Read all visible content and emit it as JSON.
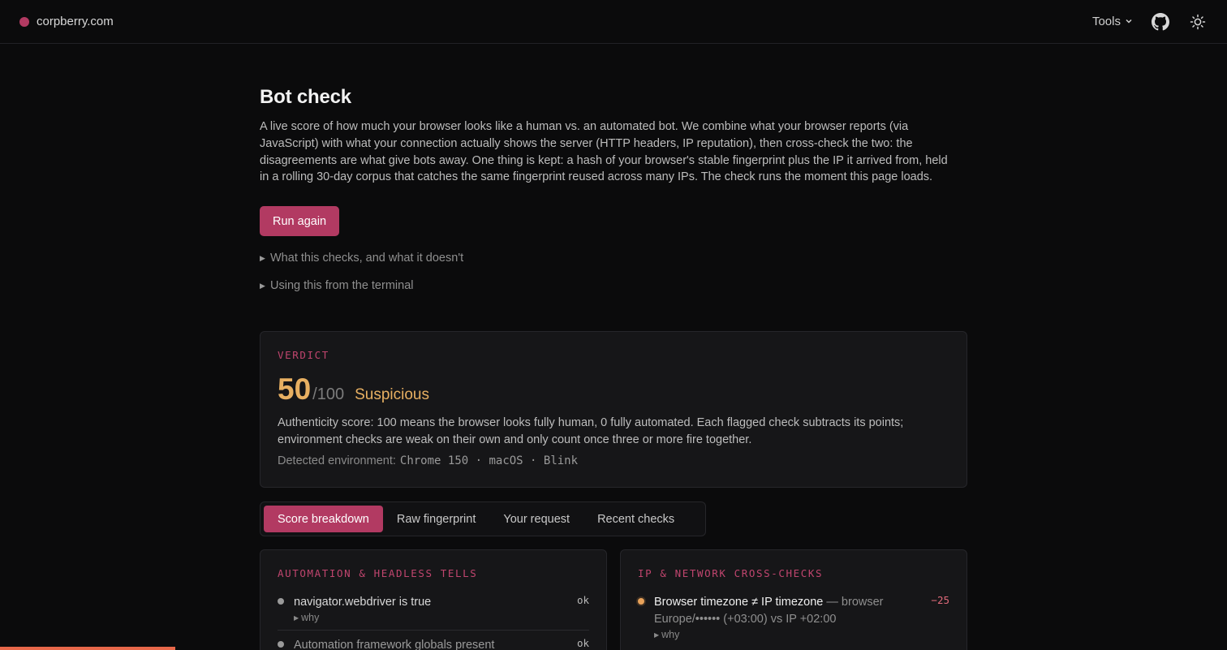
{
  "header": {
    "brand": "corpberry.com",
    "tools_label": "Tools",
    "github_icon": "github-icon",
    "theme_icon": "sun-icon",
    "accent": "#b23a62"
  },
  "main": {
    "title": "Bot check",
    "intro": "A live score of how much your browser looks like a human vs. an automated bot. We combine what your browser reports (via JavaScript) with what your connection actually shows the server (HTTP headers, IP reputation), then cross-check the two: the disagreements are what give bots away. One thing is kept: a hash of your browser's stable fingerprint plus the IP it arrived from, held in a rolling 30-day corpus that catches the same fingerprint reused across many IPs. The check runs the moment this page loads.",
    "run_button": "Run again",
    "disclosure_checks": "What this checks, and what it doesn't",
    "disclosure_terminal": "Using this from the terminal"
  },
  "verdict": {
    "label": "VERDICT",
    "score": "50",
    "out_of": "/100",
    "verdict_text": "Suspicious",
    "description": "Authenticity score: 100 means the browser looks fully human, 0 fully automated. Each flagged check subtracts its points; environment checks are weak on their own and only count once three or more fire together.",
    "env_label": "Detected environment:",
    "env_value": "Chrome 150 · macOS · Blink",
    "score_color": "#e8b062"
  },
  "tabs": [
    {
      "label": "Score breakdown",
      "active": true
    },
    {
      "label": "Raw fingerprint",
      "active": false
    },
    {
      "label": "Your request",
      "active": false
    },
    {
      "label": "Recent checks",
      "active": false
    }
  ],
  "panels": {
    "automation": {
      "title": "AUTOMATION & HEADLESS TELLS",
      "checks": [
        {
          "title": "navigator.webdriver is true",
          "status": "ok",
          "why": "why"
        },
        {
          "title": "Automation framework globals present",
          "status": "ok"
        }
      ]
    },
    "network": {
      "title": "IP & NETWORK CROSS-CHECKS",
      "checks": [
        {
          "title": "Browser timezone ≠ IP timezone",
          "detail": " — browser Europe/•••••• (+03:00) vs IP +02:00",
          "status": "−25",
          "why": "why"
        }
      ]
    }
  },
  "progress": {
    "value": 0.143,
    "color": "#e8684a"
  }
}
